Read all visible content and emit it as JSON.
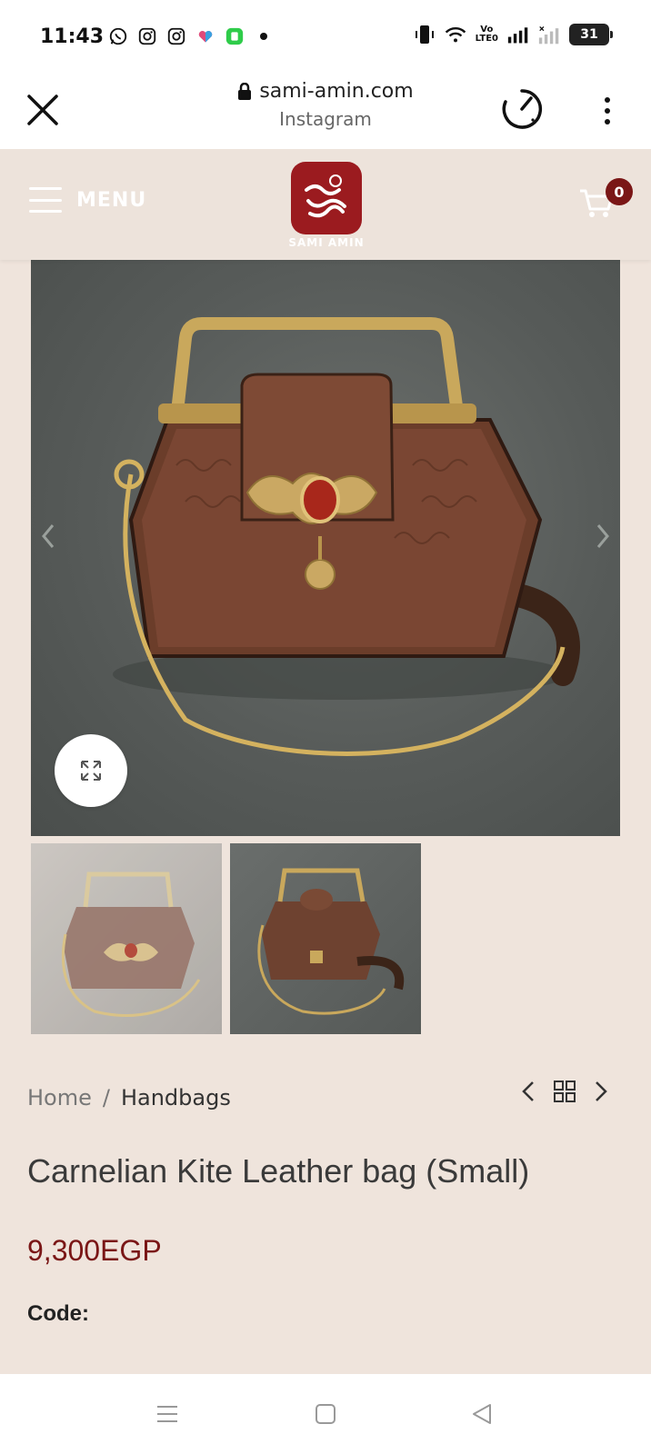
{
  "status": {
    "time": "11:43",
    "battery": "31",
    "volte_top": "Vo",
    "volte_bottom": "LTE0"
  },
  "browser": {
    "domain": "sami-amin.com",
    "source": "Instagram"
  },
  "header": {
    "menu_label": "MENU",
    "logo_caption": "SAMI AMIN",
    "cart_count": "0"
  },
  "breadcrumb": {
    "home": "Home",
    "separator": "/",
    "category": "Handbags"
  },
  "product": {
    "title": "Carnelian Kite Leather bag (Small)",
    "price": "9,300EGP",
    "code_label": "Code:"
  },
  "colors": {
    "page_bg": "#efe4dc",
    "brand_red": "#9b1b1f",
    "price": "#7a1616"
  }
}
